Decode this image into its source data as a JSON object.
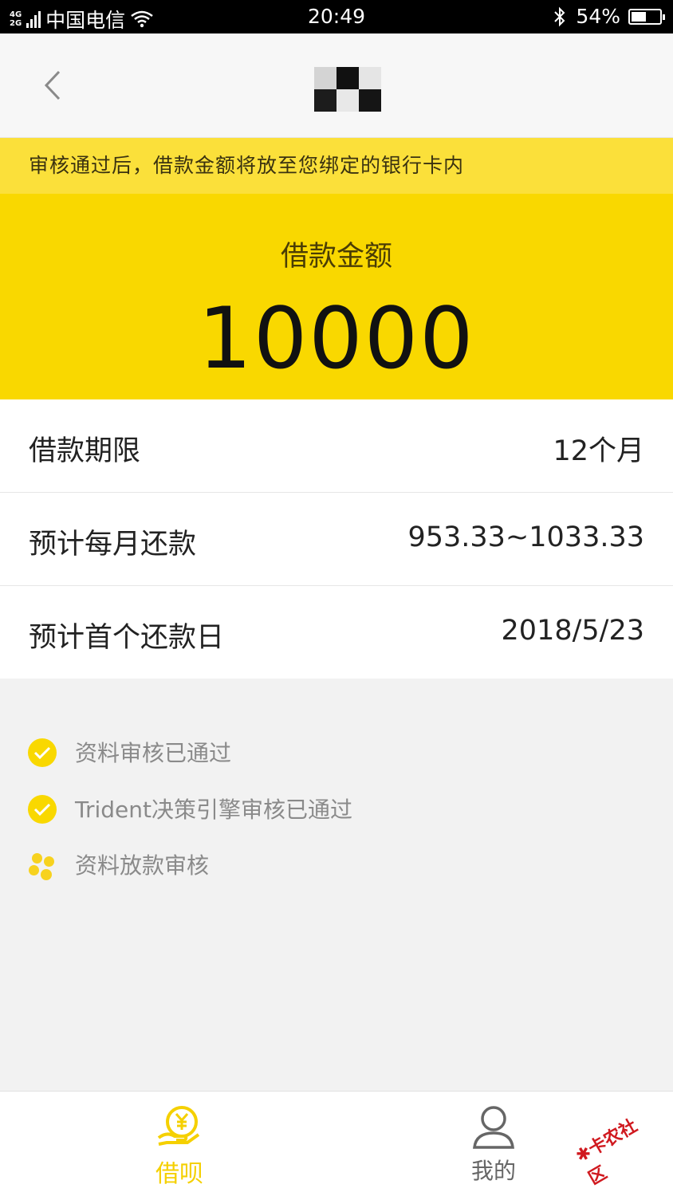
{
  "status_bar": {
    "network": "4G",
    "network2": "2G",
    "carrier": "中国电信",
    "time": "20:49",
    "battery": "54%",
    "battery_level": 0.54
  },
  "nav": {
    "back_icon": "chevron-left-icon",
    "logo_icon": "pixelated-logo"
  },
  "notice": {
    "text": "审核通过后，借款金额将放至您绑定的银行卡内"
  },
  "amount": {
    "label": "借款金额",
    "value": "10000"
  },
  "details": [
    {
      "label": "借款期限",
      "value": "12个月"
    },
    {
      "label": "预计每月还款",
      "value": "953.33~1033.33"
    },
    {
      "label": "预计首个还款日",
      "value": "2018/5/23"
    }
  ],
  "progress": [
    {
      "text": "资料审核已通过",
      "status": "done"
    },
    {
      "text": "Trident决策引擎审核已通过",
      "status": "done"
    },
    {
      "text": "资料放款审核",
      "status": "loading"
    }
  ],
  "tabs": [
    {
      "label": "借呗",
      "icon": "yuan-hand-icon",
      "active": true
    },
    {
      "label": "我的",
      "icon": "user-icon",
      "active": false
    }
  ],
  "watermark": {
    "text": "卡农社区"
  },
  "colors": {
    "accent": "#f9d800",
    "notice_bg": "#fbe03a",
    "page_bg": "#f2f2f2"
  }
}
